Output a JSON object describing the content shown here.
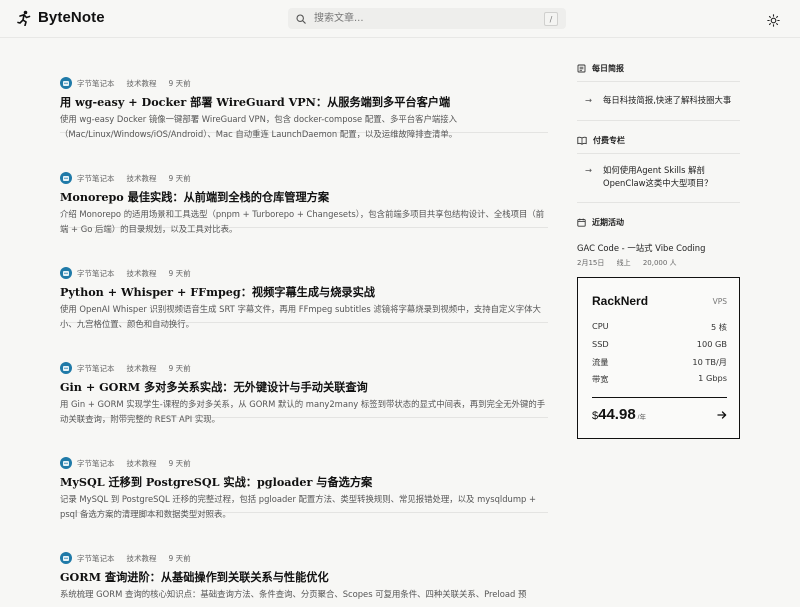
{
  "app": {
    "name": "ByteNote"
  },
  "search": {
    "placeholder": "搜索文章...",
    "shortcut": "/"
  },
  "articles": [
    {
      "author": "字节笔记本",
      "category": "技术教程",
      "time": "9 天前",
      "title": "用 wg-easy + Docker 部署 WireGuard VPN：从服务端到多平台客户端",
      "summary": "使用 wg-easy Docker 镜像一键部署 WireGuard VPN，包含 docker-compose 配置、多平台客户端接入（Mac/Linux/Windows/iOS/Android）、Mac 自动重连 LaunchDaemon 配置，以及运维故障排查清单。"
    },
    {
      "author": "字节笔记本",
      "category": "技术教程",
      "time": "9 天前",
      "title": "Monorepo 最佳实践：从前端到全栈的仓库管理方案",
      "summary": "介绍 Monorepo 的适用场景和工具选型（pnpm + Turborepo + Changesets），包含前端多项目共享包结构设计、全栈项目（前端 + Go 后端）的目录规划，以及工具对比表。"
    },
    {
      "author": "字节笔记本",
      "category": "技术教程",
      "time": "9 天前",
      "title": "Python + Whisper + FFmpeg：视频字幕生成与烧录实战",
      "summary": "使用 OpenAI Whisper 识别视频语音生成 SRT 字幕文件，再用 FFmpeg subtitles 滤镜将字幕烧录到视频中，支持自定义字体大小、九宫格位置、颜色和自动换行。"
    },
    {
      "author": "字节笔记本",
      "category": "技术教程",
      "time": "9 天前",
      "title": "Gin + GORM 多对多关系实战：无外键设计与手动关联查询",
      "summary": "用 Gin + GORM 实现学生-课程的多对多关系，从 GORM 默认的 many2many 标签到带状态的显式中间表，再到完全无外键的手动关联查询，附带完整的 REST API 实现。"
    },
    {
      "author": "字节笔记本",
      "category": "技术教程",
      "time": "9 天前",
      "title": "MySQL 迁移到 PostgreSQL 实战：pgloader 与备选方案",
      "summary": "记录 MySQL 到 PostgreSQL 迁移的完整过程，包括 pgloader 配置方法、类型转换规则、常见报错处理，以及 mysqldump + psql 备选方案的清理脚本和数据类型对照表。"
    },
    {
      "author": "字节笔记本",
      "category": "技术教程",
      "time": "9 天前",
      "title": "GORM 查询进阶：从基础操作到关联关系与性能优化",
      "summary": "系统梳理 GORM 查询的核心知识点：基础查询方法、条件查询、分页聚合、Scopes 可复用条件、四种关联关系、Preload 预"
    }
  ],
  "sidebar": {
    "daily": {
      "title": "每日简报",
      "items": [
        "每日科技简报,快速了解科技圈大事"
      ]
    },
    "paid": {
      "title": "付费专栏",
      "items": [
        "如何使用Agent Skills 解剖OpenClaw这类中大型项目？"
      ]
    },
    "events": {
      "title": "近期活动",
      "item": {
        "title": "GAC Code - 一站式 Vibe Coding",
        "date": "2月15日",
        "mode": "线上",
        "count": "20,000 人"
      }
    }
  },
  "ad": {
    "name": "RackNerd",
    "tag": "VPS",
    "specs": [
      {
        "label": "CPU",
        "value": "5 核"
      },
      {
        "label": "SSD",
        "value": "100 GB"
      },
      {
        "label": "流量",
        "value": "10 TB/月"
      },
      {
        "label": "带宽",
        "value": "1 Gbps"
      }
    ],
    "currency": "$",
    "price": "44.98",
    "period": "/年"
  },
  "colors": {
    "accent": "#1f7aa8",
    "text": "#111111",
    "muted": "#555555",
    "background": "#f7f7f5"
  }
}
